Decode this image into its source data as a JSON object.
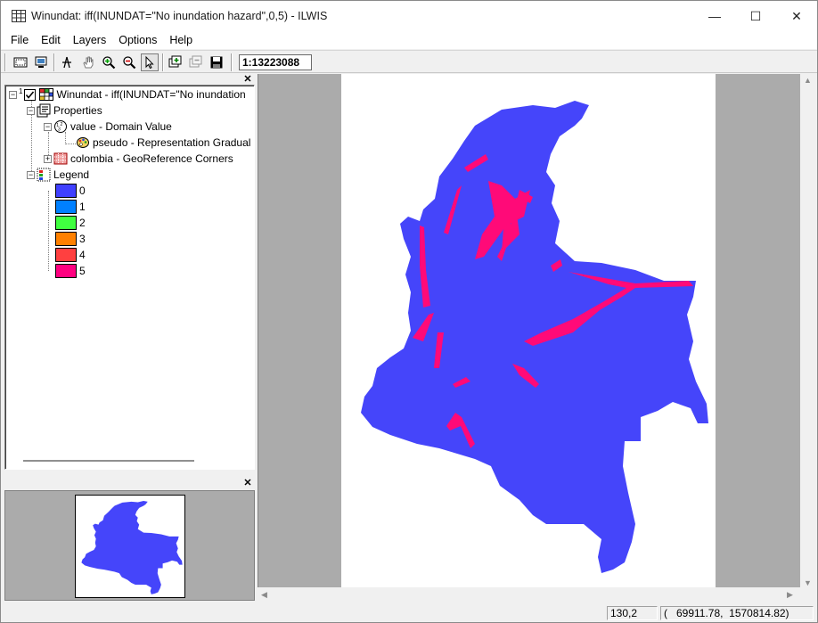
{
  "window": {
    "title": "Winundat: iff(INUNDAT=\"No inundation hazard\",0,5) - ILWIS",
    "controls": {
      "minimize": "—",
      "maximize": "☐",
      "close": "✕"
    }
  },
  "menu": [
    "File",
    "Edit",
    "Layers",
    "Options",
    "Help"
  ],
  "toolbar": {
    "scale": "1:13223088"
  },
  "tree": {
    "root_label": "Winundat - iff(INUNDAT=\"No inundation",
    "root_number": "1",
    "properties_label": "Properties",
    "domain_label": "value - Domain Value",
    "representation_label": "pseudo - Representation Gradual",
    "georef_label": "colombia - GeoReference Corners",
    "legend_label": "Legend",
    "legend": [
      {
        "label": "0",
        "color": "#4040ff"
      },
      {
        "label": "1",
        "color": "#0080ff"
      },
      {
        "label": "2",
        "color": "#40ff40"
      },
      {
        "label": "3",
        "color": "#ff8000"
      },
      {
        "label": "4",
        "color": "#ff4040"
      },
      {
        "label": "5",
        "color": "#ff0080"
      }
    ]
  },
  "map": {
    "base_color": "#4545fa",
    "hazard_color": "#ff0a78"
  },
  "status": {
    "pixel": "130,2",
    "coords": "(   69911.78,  1570814.82)"
  }
}
